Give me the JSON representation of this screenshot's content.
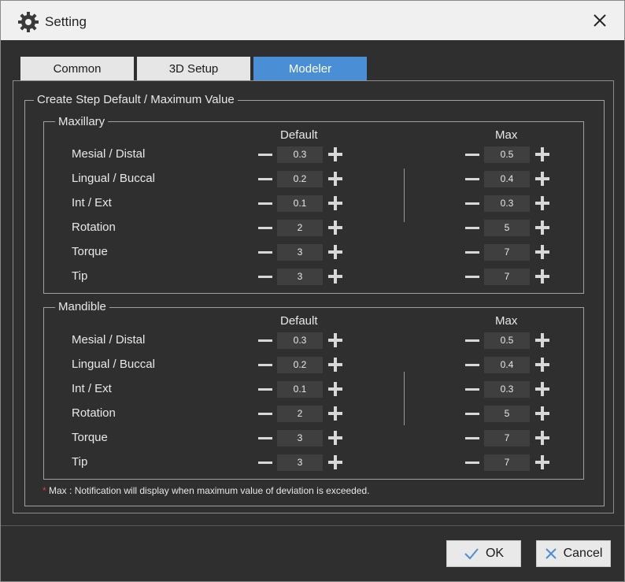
{
  "window": {
    "title": "Setting",
    "icons": {
      "app": "gear-icon",
      "close": "close-icon"
    }
  },
  "tabs": [
    {
      "label": "Common"
    },
    {
      "label": "3D Setup"
    },
    {
      "label": "Modeler",
      "active": true
    }
  ],
  "section": {
    "title": "Create Step Default / Maximum Value",
    "columns": {
      "default": "Default",
      "max": "Max"
    },
    "groups": [
      {
        "title": "Maxillary",
        "rows": [
          {
            "label": "Mesial / Distal",
            "default": "0.3",
            "max": "0.5"
          },
          {
            "label": "Lingual / Buccal",
            "default": "0.2",
            "max": "0.4"
          },
          {
            "label": "Int / Ext",
            "default": "0.1",
            "max": "0.3"
          },
          {
            "label": "Rotation",
            "default": "2",
            "max": "5"
          },
          {
            "label": "Torque",
            "default": "3",
            "max": "7"
          },
          {
            "label": "Tip",
            "default": "3",
            "max": "7"
          }
        ]
      },
      {
        "title": "Mandible",
        "rows": [
          {
            "label": "Mesial / Distal",
            "default": "0.3",
            "max": "0.5"
          },
          {
            "label": "Lingual / Buccal",
            "default": "0.2",
            "max": "0.4"
          },
          {
            "label": "Int / Ext",
            "default": "0.1",
            "max": "0.3"
          },
          {
            "label": "Rotation",
            "default": "2",
            "max": "5"
          },
          {
            "label": "Torque",
            "default": "3",
            "max": "7"
          },
          {
            "label": "Tip",
            "default": "3",
            "max": "7"
          }
        ]
      }
    ],
    "note": {
      "marker": "*",
      "text": "Max : Notification will display when maximum value of deviation is exceeded."
    }
  },
  "buttons": {
    "ok": "OK",
    "cancel": "Cancel"
  },
  "colors": {
    "accent": "#4a8fd6",
    "background": "#2f2f2f",
    "note_marker": "#e04040"
  }
}
